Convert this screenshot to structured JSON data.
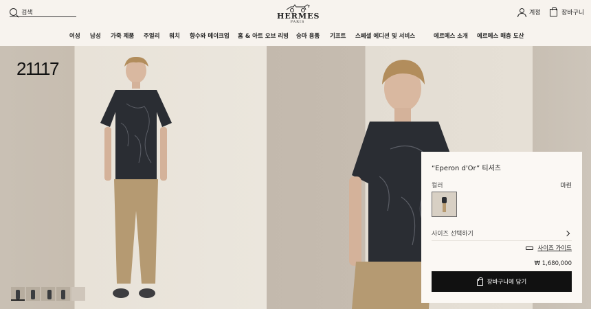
{
  "header": {
    "search_label": "검색",
    "logo_word": "HERMES",
    "logo_sub": "PARIS",
    "account_label": "계정",
    "cart_label": "장바구니"
  },
  "nav": {
    "items": [
      "여성",
      "남성",
      "가죽 제품",
      "주얼리",
      "워치",
      "향수와 메이크업",
      "홈 & 아트 오브 리빙",
      "승마 용품",
      "기프트",
      "스페셜 에디션 및 서비스",
      "에르메스 소개",
      "에르메스 매층 도산"
    ]
  },
  "gallery": {
    "lot_number": "21117",
    "thumbnail_count": 5
  },
  "product": {
    "title": "“Eperon d'Or” 티셔츠",
    "color_label": "컬러",
    "color_value": "마린",
    "size_select": "사이즈 선택하기",
    "size_guide": "사이즈 가이드",
    "price": "₩ 1,680,000",
    "add_to_cart": "장바구니에 담기"
  },
  "colors": {
    "background": "#f7f3ee",
    "button": "#111111",
    "shirt": "#2a2d33",
    "pants": "#b59a72"
  }
}
